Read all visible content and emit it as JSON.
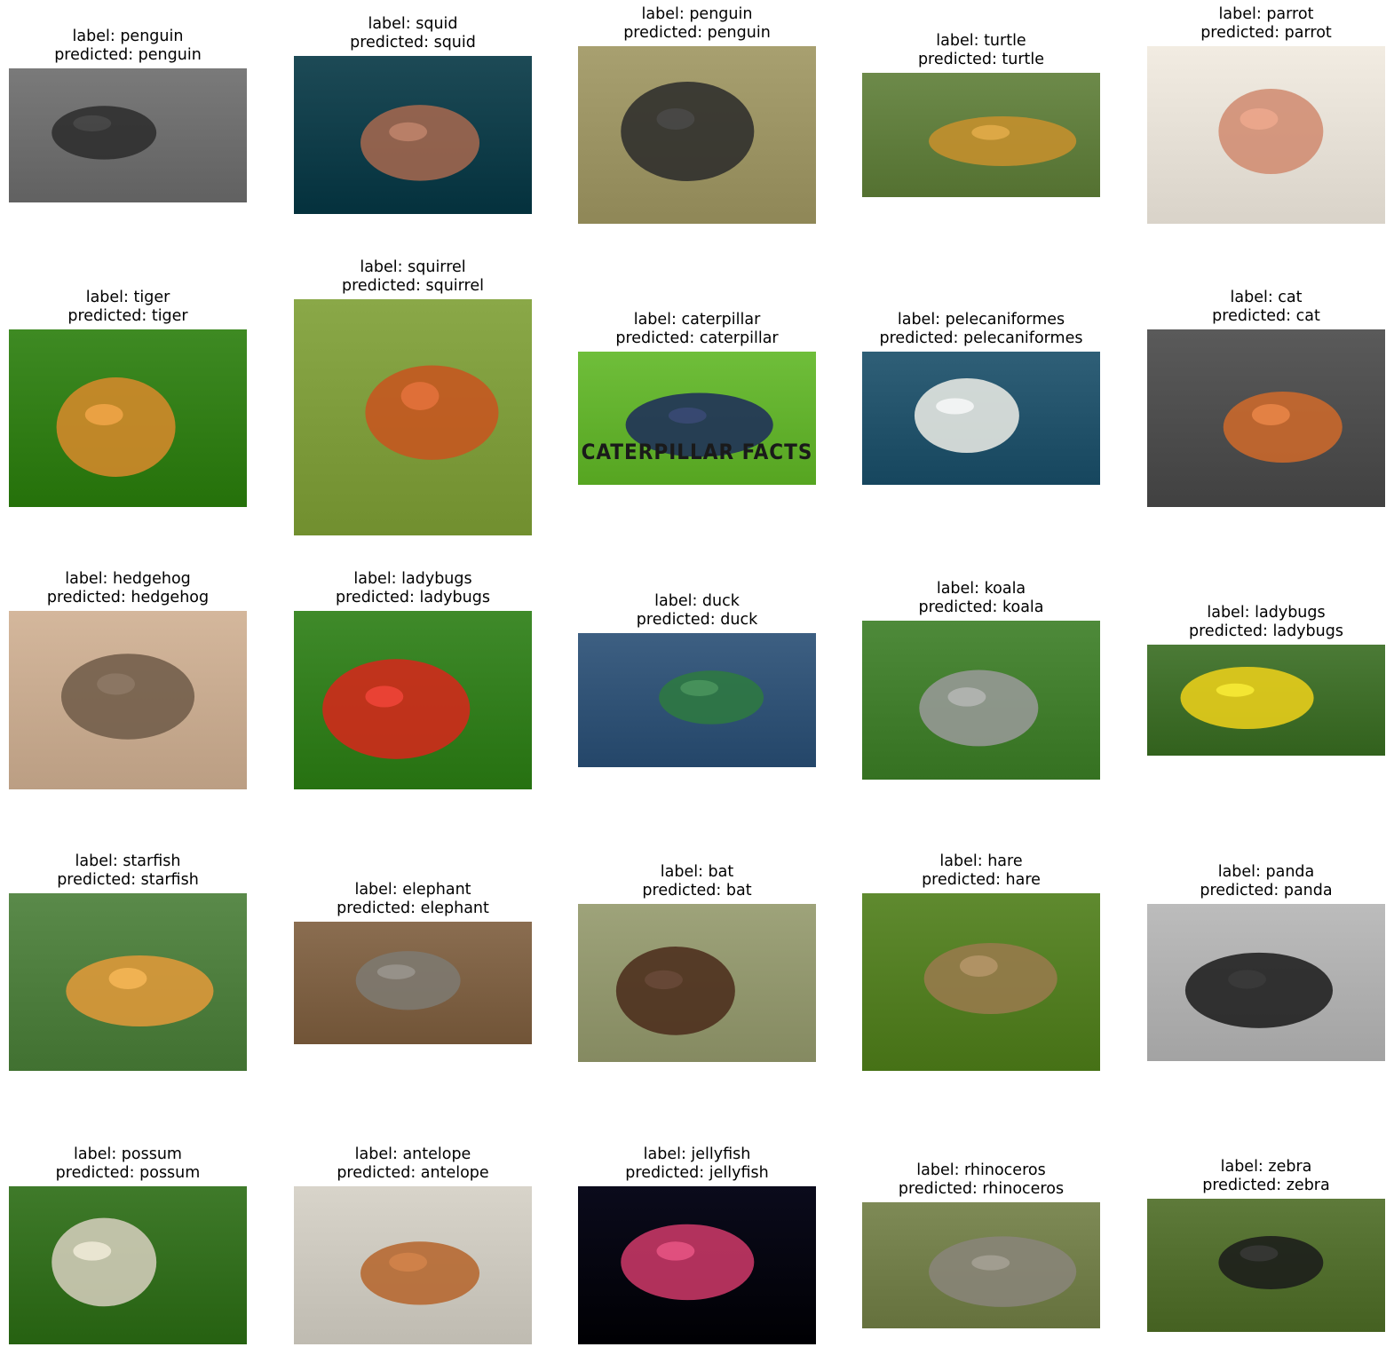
{
  "figure": {
    "items": [
      {
        "label": "label: penguin",
        "predicted": "predicted: penguin",
        "icon": "penguin-photo",
        "colors": [
          "#7a7a7a",
          "#2b2b2b"
        ]
      },
      {
        "label": "label: squid",
        "predicted": "predicted: squid",
        "icon": "squid-photo",
        "colors": [
          "#1d4a56",
          "#a8694f"
        ]
      },
      {
        "label": "label: penguin",
        "predicted": "predicted: penguin",
        "icon": "penguin-photo",
        "colors": [
          "#a8a070",
          "#2a2a2a"
        ]
      },
      {
        "label": "label: turtle",
        "predicted": "predicted: turtle",
        "icon": "turtle-photo",
        "colors": [
          "#6d8a4a",
          "#c9902d"
        ]
      },
      {
        "label": "label: parrot",
        "predicted": "predicted: parrot",
        "icon": "parrot-photo",
        "colors": [
          "#f2ece2",
          "#d08a6f"
        ]
      },
      {
        "label": "label: tiger",
        "predicted": "predicted: tiger",
        "icon": "tiger-photo",
        "colors": [
          "#3e8a23",
          "#d98a2b"
        ]
      },
      {
        "label": "label: squirrel",
        "predicted": "predicted: squirrel",
        "icon": "squirrel-photo",
        "colors": [
          "#8aa848",
          "#c9531f"
        ]
      },
      {
        "label": "label: caterpillar",
        "predicted": "predicted: caterpillar",
        "icon": "caterpillar-photo",
        "colors": [
          "#6fbe3a",
          "#1c2a5a"
        ],
        "overlay": "CATERPILLAR FACTS"
      },
      {
        "label": "label: pelecaniformes",
        "predicted": "predicted: pelecaniformes",
        "icon": "pelican-photo",
        "colors": [
          "#2f5f77",
          "#efefe8"
        ]
      },
      {
        "label": "label: cat",
        "predicted": "predicted: cat",
        "icon": "cat-photo",
        "colors": [
          "#5a5a5a",
          "#d06a2a"
        ]
      },
      {
        "label": "label: hedgehog",
        "predicted": "predicted: hedgehog",
        "icon": "hedgehog-photo",
        "colors": [
          "#d4b79c",
          "#6e5a48"
        ]
      },
      {
        "label": "label: ladybugs",
        "predicted": "predicted: ladybugs",
        "icon": "ladybug-photo",
        "colors": [
          "#3f8a2a",
          "#d8261b"
        ]
      },
      {
        "label": "label: duck",
        "predicted": "predicted: duck",
        "icon": "duck-photo",
        "colors": [
          "#3d5f82",
          "#2e7a3f"
        ]
      },
      {
        "label": "label: koala",
        "predicted": "predicted: koala",
        "icon": "koala-photo",
        "colors": [
          "#4e8a3a",
          "#9a9a9a"
        ]
      },
      {
        "label": "label: ladybugs",
        "predicted": "predicted: ladybugs",
        "icon": "ladybug-photo",
        "colors": [
          "#4b7a36",
          "#f0d21a"
        ]
      },
      {
        "label": "label: starfish",
        "predicted": "predicted: starfish",
        "icon": "starfish-photo",
        "colors": [
          "#5a8a4a",
          "#e49a3a"
        ]
      },
      {
        "label": "label: elephant",
        "predicted": "predicted: elephant",
        "icon": "elephant-photo",
        "colors": [
          "#8a6d50",
          "#7e7a72"
        ]
      },
      {
        "label": "label: bat",
        "predicted": "predicted: bat",
        "icon": "bat-photo",
        "colors": [
          "#9ea37a",
          "#4a2a1a"
        ]
      },
      {
        "label": "label: hare",
        "predicted": "predicted: hare",
        "icon": "hare-photo",
        "colors": [
          "#5f8a2f",
          "#9a7a4e"
        ]
      },
      {
        "label": "label: panda",
        "predicted": "predicted: panda",
        "icon": "panda-photo",
        "colors": [
          "#bcbcbc",
          "#1a1a1a"
        ]
      },
      {
        "label": "label: possum",
        "predicted": "predicted: possum",
        "icon": "possum-photo",
        "colors": [
          "#3f7a2a",
          "#d8d0c0"
        ]
      },
      {
        "label": "label: antelope",
        "predicted": "predicted: antelope",
        "icon": "antelope-photo",
        "colors": [
          "#d8d4ca",
          "#b5642a"
        ]
      },
      {
        "label": "label: jellyfish",
        "predicted": "predicted: jellyfish",
        "icon": "jellyfish-photo",
        "colors": [
          "#0b0b1c",
          "#d03a6a"
        ]
      },
      {
        "label": "label: rhinoceros",
        "predicted": "predicted: rhinoceros",
        "icon": "rhino-photo",
        "colors": [
          "#7e8a56",
          "#8a857a"
        ]
      },
      {
        "label": "label: zebra",
        "predicted": "predicted: zebra",
        "icon": "zebra-photo",
        "colors": [
          "#5e7a3a",
          "#1a1a1a"
        ]
      }
    ]
  }
}
